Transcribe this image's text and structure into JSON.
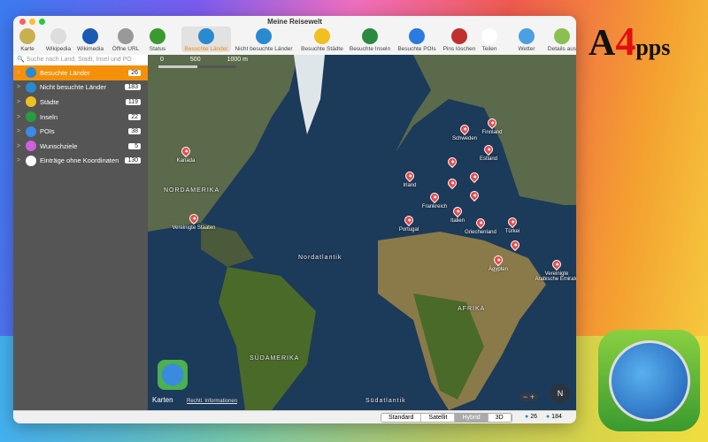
{
  "window": {
    "title": "Meine Reisewelt"
  },
  "toolbar": [
    {
      "label": "Karte",
      "icon": "map-icon"
    },
    {
      "label": "Wikipedia",
      "icon": "wikipedia-icon"
    },
    {
      "label": "Wikimedia",
      "icon": "wikimedia-icon"
    },
    {
      "label": "Öffne URL",
      "icon": "arrow-right-icon"
    },
    {
      "label": "Status",
      "icon": "status-globe-icon"
    },
    {
      "label": "Besuchte Länder",
      "icon": "globe-check-icon",
      "selected": true
    },
    {
      "label": "Nicht besuchte Länder",
      "icon": "globe-icon"
    },
    {
      "label": "Besuchte Städte",
      "icon": "city-check-icon"
    },
    {
      "label": "Besuchte Inseln",
      "icon": "island-check-icon"
    },
    {
      "label": "Besuchte POIs",
      "icon": "poi-check-icon"
    },
    {
      "label": "Pins löschen",
      "icon": "pin-delete-icon"
    },
    {
      "label": "Teilen",
      "icon": "share-icon"
    },
    {
      "label": "Wetter",
      "icon": "weather-icon"
    },
    {
      "label": "Details aus",
      "icon": "details-icon"
    }
  ],
  "search": {
    "placeholder": "Suche nach Land, Stadt, Insel und PO"
  },
  "sidebar": [
    {
      "label": "Besuchte Länder",
      "count": "26",
      "color": "#2a8ad0",
      "selected": true
    },
    {
      "label": "Nicht besuchte Länder",
      "count": "183",
      "color": "#2a8ad0"
    },
    {
      "label": "Städte",
      "count": "119",
      "color": "#f0c020"
    },
    {
      "label": "Inseln",
      "count": "22",
      "color": "#2a9a40"
    },
    {
      "label": "POIs",
      "count": "38",
      "color": "#3a8ae8"
    },
    {
      "label": "Wunschziele",
      "count": "5",
      "color": "#d060e0"
    },
    {
      "label": "Einträge ohne Koordinaten",
      "count": "130",
      "color": "#ffffff"
    }
  ],
  "map": {
    "scale": [
      "0",
      "500",
      "1000 m"
    ],
    "regions": [
      "NORDAMERIKA",
      "Nordatlantik",
      "AFRIKA",
      "SÜDAMERIKA",
      "Südatlantik"
    ],
    "pins": [
      "Kanada",
      "Vereinigte Staaten",
      "Finnland",
      "Schweden",
      "Estland",
      "Irland",
      "Frankreich",
      "Portugal",
      "Italien",
      "Griechenland",
      "Türkei",
      "Ägypten",
      "Vereinigte Arabische Emirate",
      "",
      "",
      "",
      "",
      ""
    ],
    "brand": "Karten",
    "legal": "Rechtl. Informationen",
    "compass": "N",
    "zoom_out": "−",
    "zoom_in": "+"
  },
  "bottom": {
    "modes": [
      "Standard",
      "Satellit",
      "Hybrid",
      "3D"
    ],
    "selected_mode": "Hybrid",
    "visited": "26",
    "total": "184"
  },
  "overlay": {
    "logo": "Apps4Me"
  }
}
